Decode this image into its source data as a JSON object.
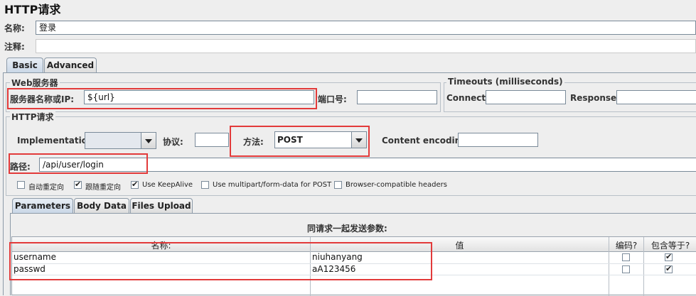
{
  "window": {
    "title": "HTTP请求"
  },
  "name": {
    "label": "名称:",
    "value": "登录"
  },
  "comment": {
    "label": "注释:",
    "value": ""
  },
  "tabs": [
    {
      "label": "Basic"
    },
    {
      "label": "Advanced"
    }
  ],
  "web_server": {
    "group_title": "Web服务器",
    "server_label": "服务器名称或IP:",
    "server_value": "${url}",
    "port_label": "端口号:",
    "port_value": ""
  },
  "timeouts": {
    "group_title": "Timeouts (milliseconds)",
    "connect_label": "Connect:",
    "connect_value": "",
    "response_label": "Response:",
    "response_value": ""
  },
  "http_request": {
    "group_title": "HTTP请求",
    "implementation_label": "Implementation:",
    "implementation_value": "",
    "protocol_label": "协议:",
    "protocol_value": "",
    "method_label": "方法:",
    "method_value": "POST",
    "encoding_label": "Content encoding:",
    "encoding_value": "",
    "path_label": "路径:",
    "path_value": "/api/user/login"
  },
  "options": [
    {
      "label": "自动重定向",
      "checked": false
    },
    {
      "label": "跟随重定向",
      "checked": true
    },
    {
      "label": "Use KeepAlive",
      "checked": true
    },
    {
      "label": "Use multipart/form-data for POST",
      "checked": false
    },
    {
      "label": "Browser-compatible headers",
      "checked": false
    }
  ],
  "param_tabs": [
    {
      "label": "Parameters"
    },
    {
      "label": "Body Data"
    },
    {
      "label": "Files Upload"
    }
  ],
  "params_table": {
    "caption": "同请求一起发送参数:",
    "headers": {
      "name": "名称:",
      "value": "值",
      "encode": "编码?",
      "include_equals": "包含等于?"
    },
    "rows": [
      {
        "name": "username",
        "value": "niuhanyang",
        "encode": false,
        "include_equals": true
      },
      {
        "name": "passwd",
        "value": "aA123456",
        "encode": false,
        "include_equals": true
      }
    ]
  },
  "colors": {
    "highlight": "#e23a3a",
    "background": "#eeeeee",
    "tab_active": "#c8d6e6"
  }
}
